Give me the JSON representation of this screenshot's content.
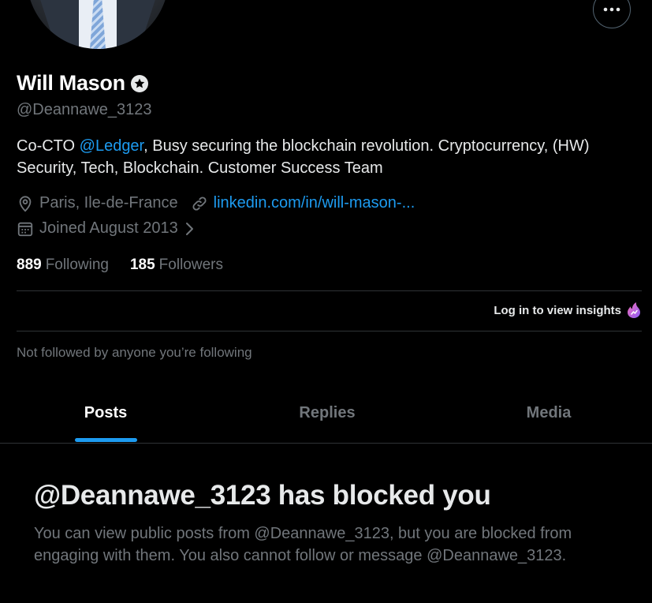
{
  "profile": {
    "name": "Will Mason",
    "handle": "@Deannawe_3123",
    "bio_prefix": "Co-CTO ",
    "bio_mention": "@Ledger",
    "bio_suffix": ", Busy securing the blockchain revolution. Cryptocurrency, (HW) Security, Tech, Blockchain. Customer Success Team",
    "location": "Paris, Ile-de-France",
    "website": "linkedin.com/in/will-mason-...",
    "joined": "Joined August 2013",
    "following_count": "889",
    "following_label": "Following",
    "followers_count": "185",
    "followers_label": "Followers"
  },
  "insights": {
    "label": "Log in to view insights"
  },
  "not_followed_text": "Not followed by anyone you’re following",
  "tabs": [
    {
      "label": "Posts",
      "selected": true
    },
    {
      "label": "Replies",
      "selected": false
    },
    {
      "label": "Media",
      "selected": false
    }
  ],
  "blocked": {
    "title": "@Deannawe_3123 has blocked you",
    "message": "You can view public posts from @Deannawe_3123, but you are blocked from engaging with them. You also cannot follow or message @Deannawe_3123."
  },
  "icons": {
    "more": "more-horizontal-icon",
    "badge": "verified-badge-icon",
    "location": "location-pin-icon",
    "link": "link-icon",
    "calendar": "calendar-icon",
    "chevron": "chevron-right-icon",
    "insights": "insights-icon"
  },
  "colors": {
    "background": "#000000",
    "accent": "#1d9bf0",
    "text_primary": "#e7e9ea",
    "text_secondary": "#71767b",
    "border": "#2f3336"
  }
}
